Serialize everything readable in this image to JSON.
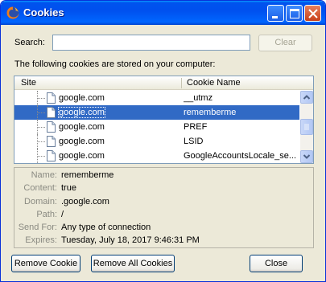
{
  "window": {
    "title": "Cookies",
    "app_icon": "firefox-icon",
    "controls": [
      "minimize-icon",
      "maximize-icon",
      "close-icon"
    ]
  },
  "search": {
    "label": "Search:",
    "value": "",
    "placeholder": "",
    "clear_label": "Clear"
  },
  "info_text": "The following cookies are stored on your computer:",
  "table": {
    "columns": [
      "Site",
      "Cookie Name"
    ],
    "rows": [
      {
        "site": "google.com",
        "name": "__utmz",
        "selected": false
      },
      {
        "site": "google.com",
        "name": "rememberme",
        "selected": true
      },
      {
        "site": "google.com",
        "name": "PREF",
        "selected": false
      },
      {
        "site": "google.com",
        "name": "LSID",
        "selected": false
      },
      {
        "site": "google.com",
        "name": "GoogleAccountsLocale_se...",
        "selected": false
      }
    ]
  },
  "details": {
    "name_label": "Name:",
    "name": "rememberme",
    "content_label": "Content:",
    "content": "true",
    "domain_label": "Domain:",
    "domain": ".google.com",
    "path_label": "Path:",
    "path": "/",
    "sendfor_label": "Send For:",
    "sendfor": "Any type of connection",
    "expires_label": "Expires:",
    "expires": "Tuesday, July 18, 2017 9:46:31 PM"
  },
  "buttons": {
    "remove_cookie": "Remove Cookie",
    "remove_all": "Remove All Cookies",
    "close": "Close"
  },
  "colors": {
    "titlebar": "#0053ee",
    "selection": "#316ac5",
    "dialog_bg": "#ece9d8"
  }
}
